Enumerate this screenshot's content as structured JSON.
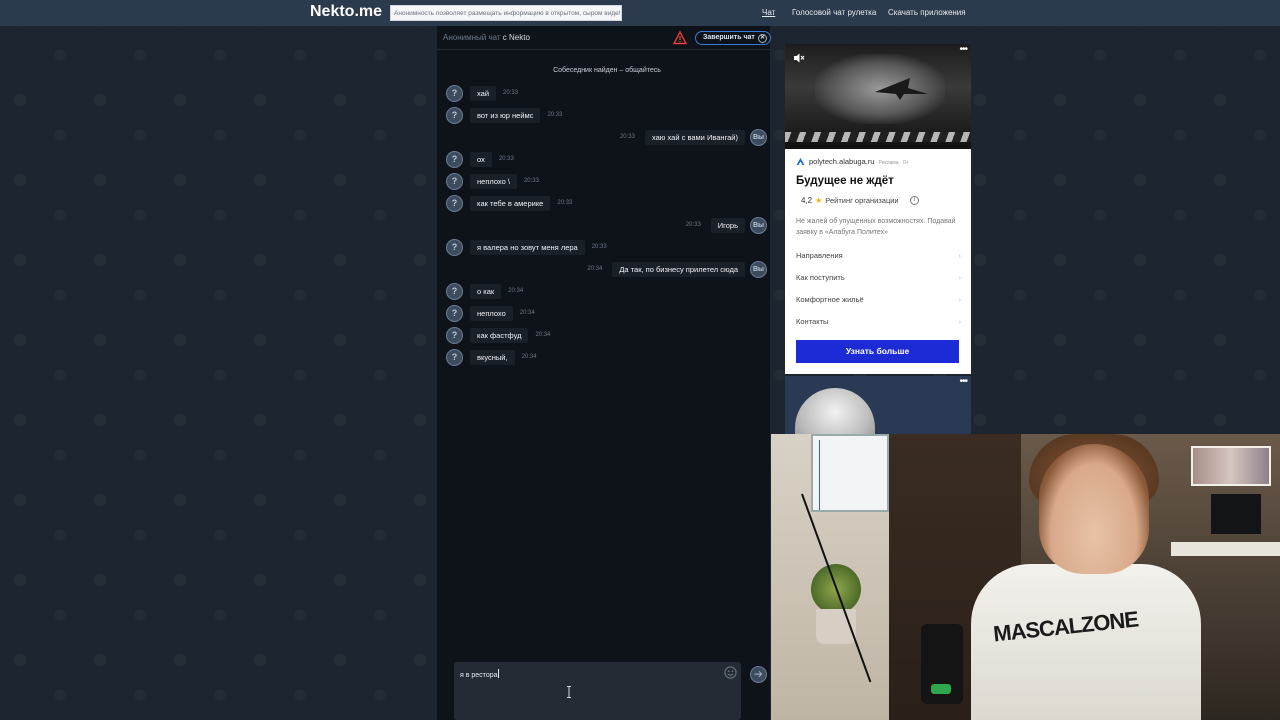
{
  "header": {
    "logo": "Nekto.me",
    "notice": "Анонимность позволяет размещать информацию в открытом, сыром виде!",
    "nav": {
      "chat": "Чат",
      "voice_roulette": "Голосовой чат рулетка",
      "download_apps": "Скачать приложения"
    }
  },
  "chat": {
    "title_anon": "Анонимный чат",
    "title_with": "с Nekto",
    "end_chat_label": "Завершить чат",
    "system_message": "Собеседник найден – общайтесь",
    "incoming_avatar": "?",
    "outgoing_avatar": "Вы",
    "messages": [
      {
        "side": "in",
        "text": "хай",
        "time": "20:33"
      },
      {
        "side": "in",
        "text": "вот из юр неймс",
        "time": "20:33"
      },
      {
        "side": "out",
        "text": "хаю хай с вами Ивангай)",
        "time": "20:33"
      },
      {
        "side": "in",
        "text": "ох",
        "time": "20:33"
      },
      {
        "side": "in",
        "text": "неплохо \\",
        "time": "20:33"
      },
      {
        "side": "in",
        "text": "как тебе в америке",
        "time": "20:33"
      },
      {
        "side": "out",
        "text": "Игорь",
        "time": "20:33"
      },
      {
        "side": "in",
        "text": "я валера но зовут меня лера",
        "time": "20:33"
      },
      {
        "side": "out",
        "text": "Да так, по бизнесу прилетел сюда",
        "time": "20:34"
      },
      {
        "side": "in",
        "text": "о как",
        "time": "20:34"
      },
      {
        "side": "in",
        "text": "неплохо",
        "time": "20:34"
      },
      {
        "side": "in",
        "text": "как фастфуд",
        "time": "20:34"
      },
      {
        "side": "in",
        "text": "вкусный,",
        "time": "20:34"
      }
    ],
    "input_value": "я в рестора"
  },
  "ad": {
    "domain": "polytech.alabuga.ru",
    "domain_tag": "Реклама · 0+",
    "title": "Будущее не ждёт",
    "rating_value": "4,2",
    "rating_label": "Рейтинг организации",
    "description": "Не жалей об упущенных возможностях. Подавай заявку в «Алабуга Политех»",
    "links": [
      "Направления",
      "Как поступить",
      "Комфортное жильё",
      "Контакты"
    ],
    "cta": "Узнать больше"
  },
  "webcam": {
    "shirt_print": "MASCALZONE"
  },
  "colors": {
    "page_bg": "#1e2730",
    "topbar": "#2b3a4c",
    "chat_bg": "#0e131a",
    "bubble": "#1a2028",
    "accent_blue": "#3a7bd5",
    "ad_cta": "#1d2bd6",
    "warning_red": "#e23b3b"
  },
  "icons": {
    "warning": "warning-triangle-icon",
    "close": "close-icon",
    "emoji": "smiley-icon",
    "send": "send-icon",
    "mute": "mute-icon",
    "star": "star-icon",
    "info": "info-icon",
    "chevron": "chevron-right-icon"
  }
}
